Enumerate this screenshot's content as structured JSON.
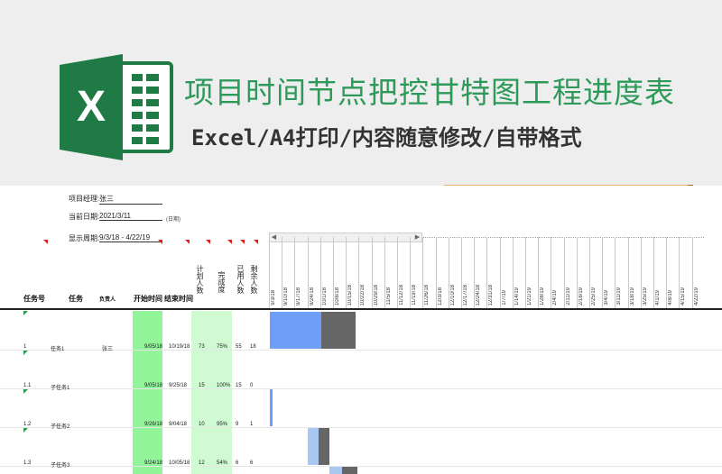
{
  "banner": {
    "title": "项目时间节点把控甘特图工程进度表",
    "subtitle": "Excel/A4打印/内容随意修改/自带格式",
    "logo_letter": "X",
    "accent": "#2e9a5a"
  },
  "sheet": {
    "info": {
      "manager_label": "项目经理:",
      "manager_value": "张三",
      "date_label": "当前日期:",
      "date_value": "2021/3/11",
      "date_note": "(日期)",
      "range_label": "显示周期:",
      "range_value": "9/3/18 - 4/22/19"
    },
    "headers": {
      "task_no": "任务号",
      "task": "任务",
      "owner": "负责人",
      "start_end": "开始时间",
      "end": "结束时间",
      "planned": "计划人数",
      "done_rate": "完成度",
      "used": "已用人数",
      "remaining": "剩余人数"
    },
    "dates": [
      "9/3/18",
      "9/10/18",
      "9/17/18",
      "9/24/18",
      "10/1/18",
      "10/8/18",
      "10/15/18",
      "10/22/18",
      "10/29/18",
      "11/5/18",
      "11/12/18",
      "11/19/18",
      "11/26/18",
      "12/3/18",
      "12/10/18",
      "12/17/18",
      "12/24/18",
      "12/31/18",
      "1/7/19",
      "1/14/19",
      "1/21/19",
      "1/28/19",
      "2/4/19",
      "2/11/19",
      "2/18/19",
      "2/25/19",
      "3/4/19",
      "3/11/19",
      "3/18/19",
      "3/25/19",
      "4/1/19",
      "4/8/19",
      "4/15/19",
      "4/22/19"
    ],
    "rows": [
      {
        "no": "1",
        "task": "任务1",
        "owner": "张三",
        "start": "9/05/18",
        "end": "10/19/18",
        "planned": "73",
        "done": "75%",
        "used": "55",
        "remaining": "18"
      },
      {
        "no": "1.1",
        "task": "子任务1",
        "owner": "",
        "start": "9/05/18",
        "end": "9/25/18",
        "planned": "15",
        "done": "100%",
        "used": "15",
        "remaining": "0"
      },
      {
        "no": "1.2",
        "task": "子任务2",
        "owner": "",
        "start": "9/26/18",
        "end": "9/04/18",
        "planned": "10",
        "done": "95%",
        "used": "9",
        "remaining": "1"
      },
      {
        "no": "1.3",
        "task": "子任务3",
        "owner": "",
        "start": "9/24/18",
        "end": "10/05/18",
        "planned": "12",
        "done": "54%",
        "used": "6",
        "remaining": "6"
      }
    ],
    "colors": {
      "green_col": "#92f59a",
      "green_light": "#cffad2",
      "bar_blue": "#6d9ef8",
      "bar_light_blue": "#a8c8f2",
      "bar_gray": "#666666",
      "flag_red": "#e0221d"
    }
  }
}
